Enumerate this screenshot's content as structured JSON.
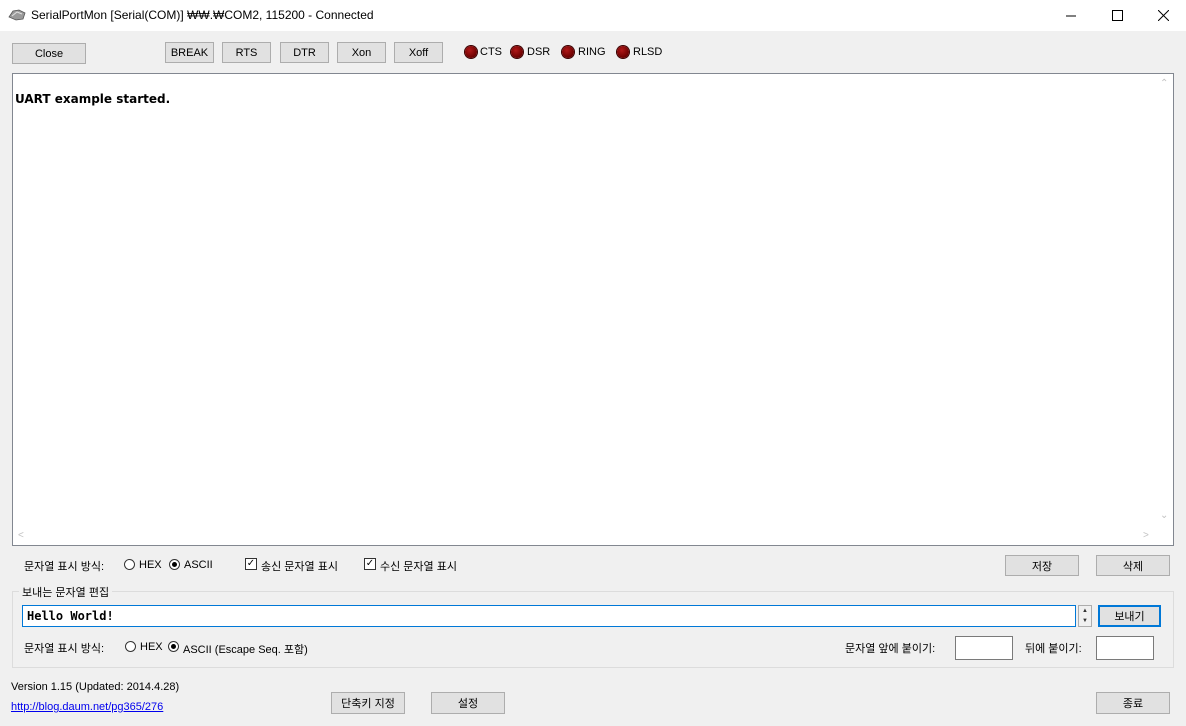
{
  "window": {
    "title": "SerialPortMon [Serial(COM)] ₩₩.₩COM2, 115200 - Connected",
    "minimize": "—",
    "maximize": "☐",
    "close": "✕"
  },
  "toolbar": {
    "close_label": "Close",
    "break_label": "BREAK",
    "rts_label": "RTS",
    "dtr_label": "DTR",
    "xon_label": "Xon",
    "xoff_label": "Xoff",
    "indicators": [
      {
        "label": "CTS",
        "color": "#8b0000"
      },
      {
        "label": "DSR",
        "color": "#8b0000"
      },
      {
        "label": "RING",
        "color": "#8b0000"
      },
      {
        "label": "RLSD",
        "color": "#8b0000"
      }
    ]
  },
  "receive": {
    "text": "UART example started.",
    "display_mode_label": "문자열 표시 방식:",
    "hex_label": "HEX",
    "ascii_label": "ASCII",
    "selected_mode": "ASCII",
    "show_sent_label": "송신 문자열 표시",
    "show_sent_checked": true,
    "show_recv_label": "수신 문자열 표시",
    "show_recv_checked": true,
    "save_label": "저장",
    "delete_label": "삭제"
  },
  "send": {
    "group_title": "보내는 문자열 편집",
    "input_value": "Hello World!",
    "send_label": "보내기",
    "display_mode_label": "문자열 표시 방식:",
    "hex_label": "HEX",
    "ascii_label": "ASCII (Escape Seq. 포함)",
    "selected_mode": "ASCII",
    "prefix_label": "문자열 앞에 붙이기:",
    "prefix_value": "",
    "suffix_label": "뒤에 붙이기:",
    "suffix_value": ""
  },
  "footer": {
    "version": "Version 1.15 (Updated: 2014.4.28)",
    "link": "http://blog.daum.net/pg365/276",
    "shortcut_label": "단축키 지정",
    "settings_label": "설정",
    "exit_label": "종료"
  },
  "icons": {
    "check": "✓",
    "up": "▲",
    "down": "▼",
    "left": "<",
    "right": ">"
  }
}
